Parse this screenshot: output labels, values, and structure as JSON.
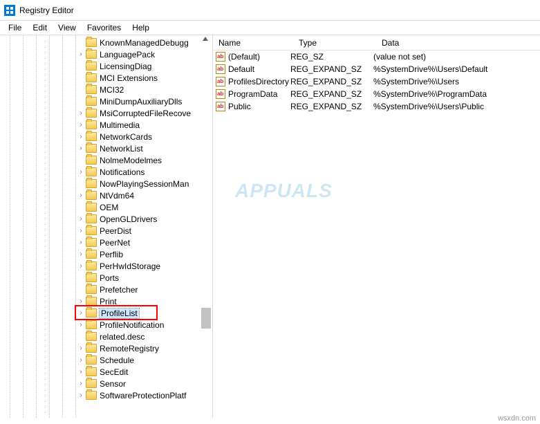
{
  "window": {
    "title": "Registry Editor"
  },
  "menubar": {
    "file": "File",
    "edit": "Edit",
    "view": "View",
    "favorites": "Favorites",
    "help": "Help"
  },
  "tree": {
    "items": [
      {
        "label": "KnownManagedDebugg",
        "expandable": false
      },
      {
        "label": "LanguagePack",
        "expandable": true
      },
      {
        "label": "LicensingDiag",
        "expandable": false
      },
      {
        "label": "MCI Extensions",
        "expandable": false
      },
      {
        "label": "MCI32",
        "expandable": false
      },
      {
        "label": "MiniDumpAuxiliaryDlls",
        "expandable": false
      },
      {
        "label": "MsiCorruptedFileRecove",
        "expandable": true
      },
      {
        "label": "Multimedia",
        "expandable": true
      },
      {
        "label": "NetworkCards",
        "expandable": true
      },
      {
        "label": "NetworkList",
        "expandable": true
      },
      {
        "label": "NolmeModelmes",
        "expandable": false
      },
      {
        "label": "Notifications",
        "expandable": true
      },
      {
        "label": "NowPlayingSessionMan",
        "expandable": false
      },
      {
        "label": "NtVdm64",
        "expandable": true
      },
      {
        "label": "OEM",
        "expandable": false
      },
      {
        "label": "OpenGLDrivers",
        "expandable": true
      },
      {
        "label": "PeerDist",
        "expandable": true
      },
      {
        "label": "PeerNet",
        "expandable": true
      },
      {
        "label": "Perflib",
        "expandable": true
      },
      {
        "label": "PerHwIdStorage",
        "expandable": true
      },
      {
        "label": "Ports",
        "expandable": false
      },
      {
        "label": "Prefetcher",
        "expandable": false
      },
      {
        "label": "Print",
        "expandable": true
      },
      {
        "label": "ProfileList",
        "expandable": true,
        "selected": true,
        "highlighted": true
      },
      {
        "label": "ProfileNotification",
        "expandable": true
      },
      {
        "label": "related.desc",
        "expandable": false
      },
      {
        "label": "RemoteRegistry",
        "expandable": true
      },
      {
        "label": "Schedule",
        "expandable": true
      },
      {
        "label": "SecEdit",
        "expandable": true
      },
      {
        "label": "Sensor",
        "expandable": true
      },
      {
        "label": "SoftwareProtectionPlatf",
        "expandable": true
      }
    ]
  },
  "list": {
    "columns": {
      "name": "Name",
      "type": "Type",
      "data": "Data"
    },
    "rows": [
      {
        "name": "(Default)",
        "type": "REG_SZ",
        "data": "(value not set)"
      },
      {
        "name": "Default",
        "type": "REG_EXPAND_SZ",
        "data": "%SystemDrive%\\Users\\Default"
      },
      {
        "name": "ProfilesDirectory",
        "type": "REG_EXPAND_SZ",
        "data": "%SystemDrive%\\Users"
      },
      {
        "name": "ProgramData",
        "type": "REG_EXPAND_SZ",
        "data": "%SystemDrive%\\ProgramData"
      },
      {
        "name": "Public",
        "type": "REG_EXPAND_SZ",
        "data": "%SystemDrive%\\Users\\Public"
      }
    ]
  },
  "watermark": {
    "text": "APPUALS"
  },
  "source": {
    "label": "wsxdn.com"
  }
}
